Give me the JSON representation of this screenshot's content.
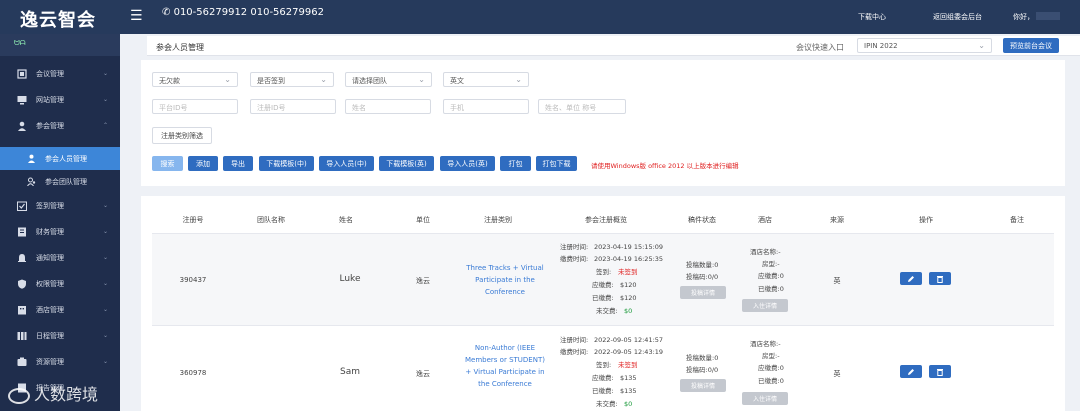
{
  "topbar": {
    "logo": "逸云智会",
    "phone": "010-56279912  010-56279962",
    "download": "下载中心",
    "back": "返回组委会后台",
    "greeting": "你好，"
  },
  "sidebar": {
    "top_label": "ᗢᗩ",
    "items": [
      {
        "label": "会议管理",
        "icon": "meeting-icon"
      },
      {
        "label": "网站管理",
        "icon": "monitor-icon"
      },
      {
        "label": "参会管理",
        "icon": "user-icon"
      }
    ],
    "subitems": [
      {
        "label": "参会人员管理",
        "active": true
      },
      {
        "label": "参会团队管理",
        "active": false
      }
    ],
    "items2": [
      {
        "label": "签到管理",
        "icon": "checkin-icon"
      },
      {
        "label": "财务管理",
        "icon": "finance-icon"
      },
      {
        "label": "通知管理",
        "icon": "bell-icon"
      },
      {
        "label": "权限管理",
        "icon": "shield-icon"
      },
      {
        "label": "酒店管理",
        "icon": "hotel-icon"
      },
      {
        "label": "日程管理",
        "icon": "schedule-icon"
      },
      {
        "label": "资源管理",
        "icon": "resource-icon"
      },
      {
        "label": "报告管理",
        "icon": "report-icon"
      }
    ]
  },
  "watermark": "人数跨境",
  "page": {
    "title": "参会人员管理"
  },
  "quick": {
    "label": "会议快速入口",
    "value": "IPIN 2022",
    "btn": "预览前台会议"
  },
  "filters": {
    "row1": [
      "无欠款",
      "是否签到",
      "请选择团队",
      "英文"
    ],
    "row2": [
      "平台ID号",
      "注册ID号",
      "姓名",
      "手机",
      "姓名、单位 称号"
    ],
    "reg_filter": "注册类别筛选"
  },
  "actions": {
    "buttons": [
      "搜索",
      "添加",
      "导出",
      "下载模板(中)",
      "导入人员(中)",
      "下载模板(英)",
      "导入人员(英)",
      "打包",
      "打包下载"
    ],
    "note": "请使用Windows版 office 2012 以上版本进行编辑"
  },
  "table": {
    "headers": [
      "注册号",
      "团队名称",
      "姓名",
      "单位",
      "注册类别",
      "参会注册概览",
      "稿件状态",
      "酒店",
      "来源",
      "操作",
      "备注"
    ],
    "rows": [
      {
        "id": "390437",
        "name": "Luke",
        "org": "逸云",
        "category": "Three Tracks + Virtual Participate in the Conference",
        "reg_time_label": "注册时间:",
        "reg_time": "2023-04-19 15:15:09",
        "pay_time_label": "缴费时间:",
        "pay_time": "2023-04-19 16:25:35",
        "checkin_label": "签到:",
        "checkin": "未签到",
        "due_label": "应缴费:",
        "due": "$120",
        "paid_label": "已缴费:",
        "paid": "$120",
        "unpaid_label": "未交费:",
        "unpaid": "$0",
        "paper_count": "投稿数量:0",
        "paper_code": "投稿码:0/0",
        "paper_btn": "投稿详情",
        "hotel_name": "酒店名称:-",
        "room_type": "房型:-",
        "hotel_due": "应缴费:0",
        "hotel_paid": "已缴费:0",
        "hotel_btn": "入住详情",
        "source": "英"
      },
      {
        "id": "360978",
        "name": "Sam",
        "org": "逸云",
        "category": "Non-Author (IEEE Members or STUDENT) + Virtual Participate in the Conference",
        "reg_time_label": "注册时间:",
        "reg_time": "2022-09-05 12:41:57",
        "pay_time_label": "缴费时间:",
        "pay_time": "2022-09-05 12:43:19",
        "checkin_label": "签到:",
        "checkin": "未签到",
        "due_label": "应缴费:",
        "due": "$135",
        "paid_label": "已缴费:",
        "paid": "$135",
        "unpaid_label": "未交费:",
        "unpaid": "$0",
        "paper_count": "投稿数量:0",
        "paper_code": "投稿码:0/0",
        "paper_btn": "投稿详情",
        "hotel_name": "酒店名称:-",
        "room_type": "房型:-",
        "hotel_due": "应缴费:0",
        "hotel_paid": "已缴费:0",
        "hotel_btn": "入住详情",
        "source": "英"
      }
    ]
  }
}
